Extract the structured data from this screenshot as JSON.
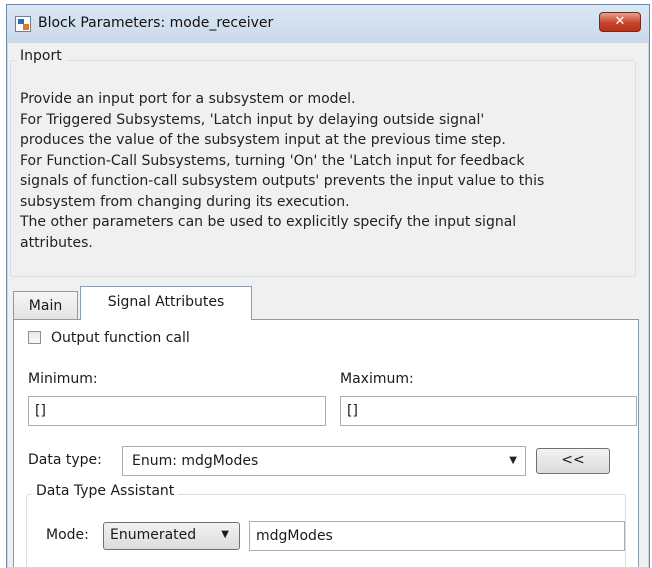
{
  "window": {
    "title": "Block Parameters: mode_receiver",
    "close_glyph": "✕",
    "icon": "simulink-block-icon"
  },
  "block": {
    "group_title": "Inport",
    "description": [
      "Provide an input port for a subsystem or model.",
      "For Triggered Subsystems, 'Latch input by delaying outside signal'",
      "produces the value of the subsystem input at the previous time step.",
      "For Function-Call Subsystems, turning 'On' the 'Latch input for feedback",
      "signals of function-call subsystem outputs' prevents the input value to this",
      "subsystem from changing during its execution.",
      "The other parameters can be used to explicitly specify the input signal",
      "attributes."
    ]
  },
  "tabs": [
    {
      "label": "Main",
      "selected": false
    },
    {
      "label": "Signal Attributes",
      "selected": true
    }
  ],
  "signal": {
    "output_function_call_label": "Output function call",
    "output_function_call_checked": false,
    "minimum_label": "Minimum:",
    "minimum_value": "[]",
    "maximum_label": "Maximum:",
    "maximum_value": "[]",
    "data_type_label": "Data type:",
    "data_type_value": "Enum: mdgModes",
    "assistant_button_label": "<<",
    "assistant_title": "Data Type Assistant",
    "mode_label": "Mode:",
    "mode_value": "Enumerated",
    "enum_name_value": "mdgModes"
  },
  "colors": {
    "close_button": "#c7432a",
    "dialog_background": "#f0f0f0",
    "panel_background": "#ffffff"
  }
}
